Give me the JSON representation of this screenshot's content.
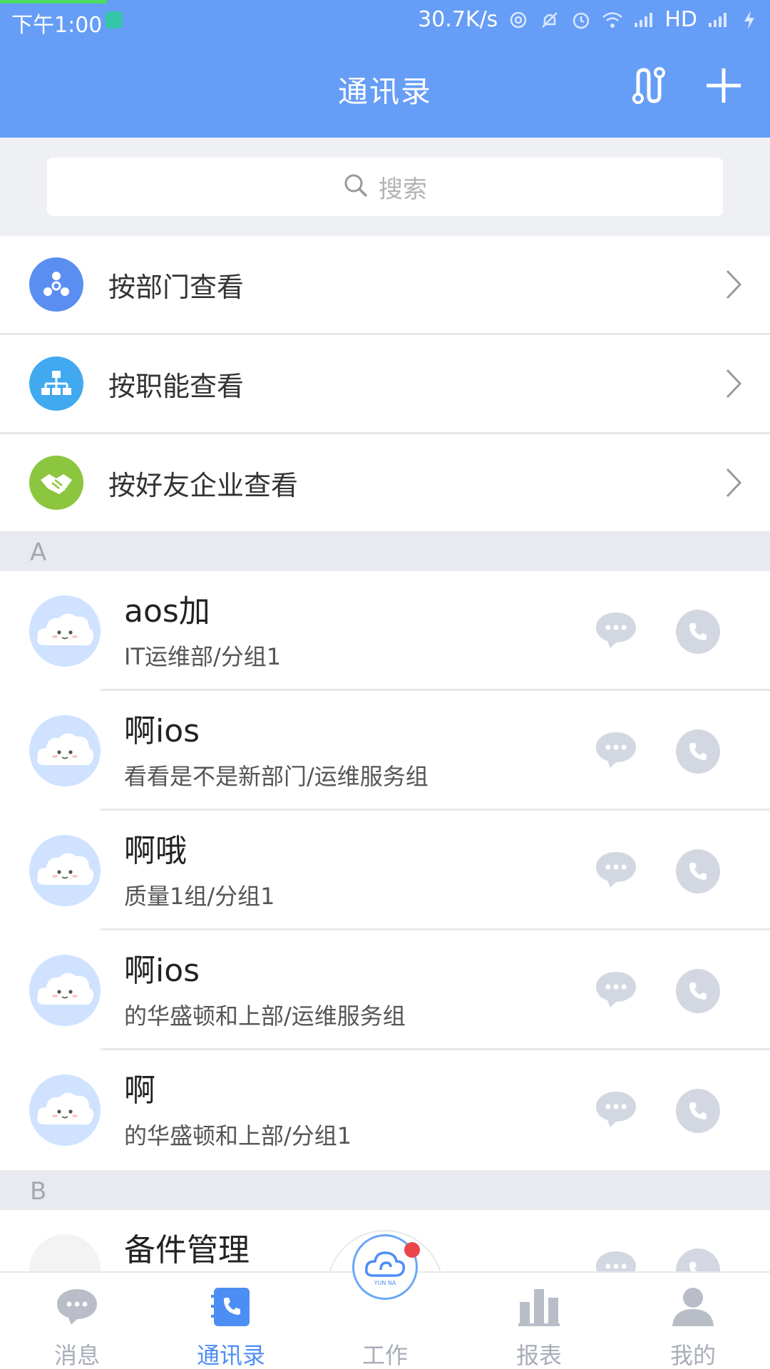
{
  "status_bar": {
    "time": "下午1:00",
    "network_speed": "30.7K/s",
    "network_type": "HD"
  },
  "header": {
    "title": "通讯录"
  },
  "search": {
    "placeholder": "搜索"
  },
  "categories": [
    {
      "label": "按部门查看",
      "icon": "department-icon",
      "color": "#5b8ef1"
    },
    {
      "label": "按职能查看",
      "icon": "org-chart-icon",
      "color": "#41a9ef"
    },
    {
      "label": "按好友企业查看",
      "icon": "handshake-icon",
      "color": "#8cc63f"
    }
  ],
  "sections": [
    {
      "letter": "A",
      "contacts": [
        {
          "name": "aos加",
          "dept": "IT运维部/分组1"
        },
        {
          "name": "啊ios",
          "dept": "看看是不是新部门/运维服务组"
        },
        {
          "name": "啊哦",
          "dept": "质量1组/分组1"
        },
        {
          "name": "啊ios",
          "dept": "的华盛顿和上部/运维服务组"
        },
        {
          "name": "啊",
          "dept": "的华盛顿和上部/分组1"
        }
      ]
    },
    {
      "letter": "B",
      "contacts": [
        {
          "name": "备件管理",
          "dept": ""
        }
      ]
    }
  ],
  "bottom_nav": {
    "items": [
      {
        "label": "消息",
        "icon": "chat-bubble-icon",
        "active": false
      },
      {
        "label": "通讯录",
        "icon": "contacts-book-icon",
        "active": true
      },
      {
        "label": "工作",
        "icon": "yunna-cloud-icon",
        "active": false
      },
      {
        "label": "报表",
        "icon": "bar-chart-icon",
        "active": false
      },
      {
        "label": "我的",
        "icon": "person-icon",
        "active": false
      }
    ],
    "center_logo_text": "YUN NA"
  },
  "colors": {
    "header": "#669df6",
    "active_tab": "#4d8ef5",
    "badge": "#e9464c"
  }
}
